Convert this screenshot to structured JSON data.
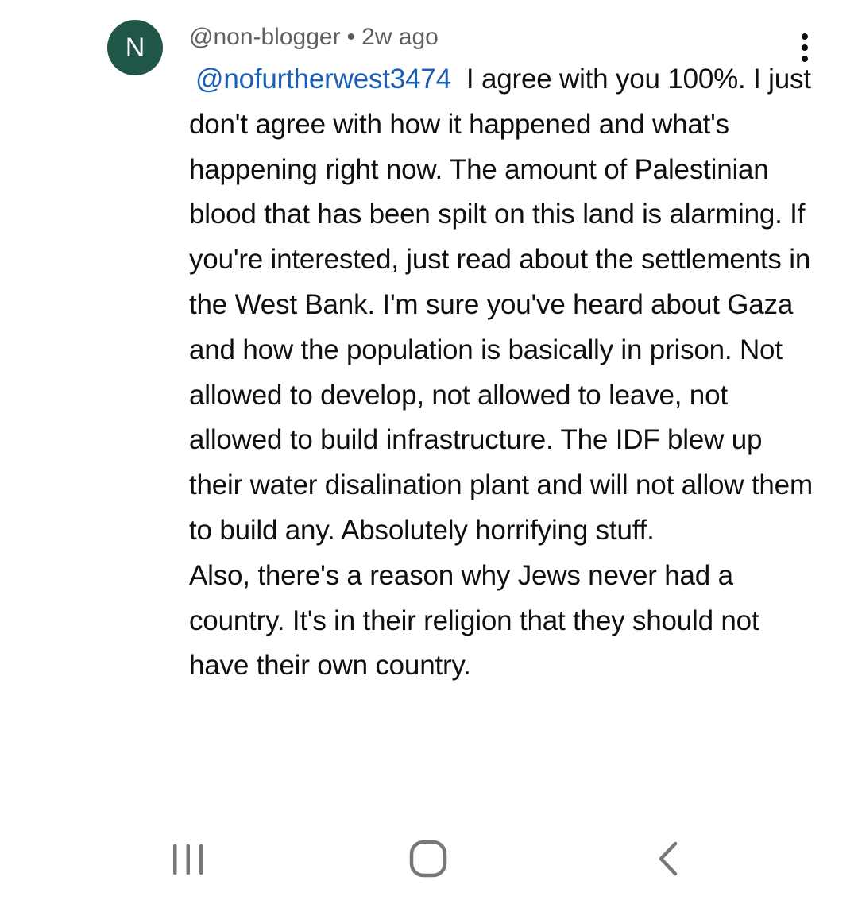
{
  "comment": {
    "avatar_letter": "N",
    "author": "@non-blogger",
    "separator": "•",
    "age": "2w ago",
    "mention": "@nofurtherwest3474",
    "body_after_mention": "I agree with you 100%. I just don't agree with how it happened and what's happening right now. The amount of Palestinian blood that has been spilt on this land is alarming. If you're interested, just read about the settlements in the West Bank. I'm sure you've heard about Gaza and how the population is basically in prison. Not allowed to develop, not allowed to leave, not allowed to build infrastructure. The IDF blew up their water disalination plant and will not allow them to build any. Absolutely horrifying stuff.",
    "body_second_paragraph": "Also, there's a reason why Jews never had a country. It's in their religion that they should not have their own country."
  },
  "icons": {
    "more_options": "more-vert-icon",
    "nav_recents": "recents-icon",
    "nav_home": "home-icon",
    "nav_back": "back-icon"
  },
  "colors": {
    "avatar_bg": "#1f5647",
    "mention": "#1a5fb4",
    "meta_text": "#606060",
    "body_text": "#0f0f0f",
    "nav_icon": "#777777"
  }
}
